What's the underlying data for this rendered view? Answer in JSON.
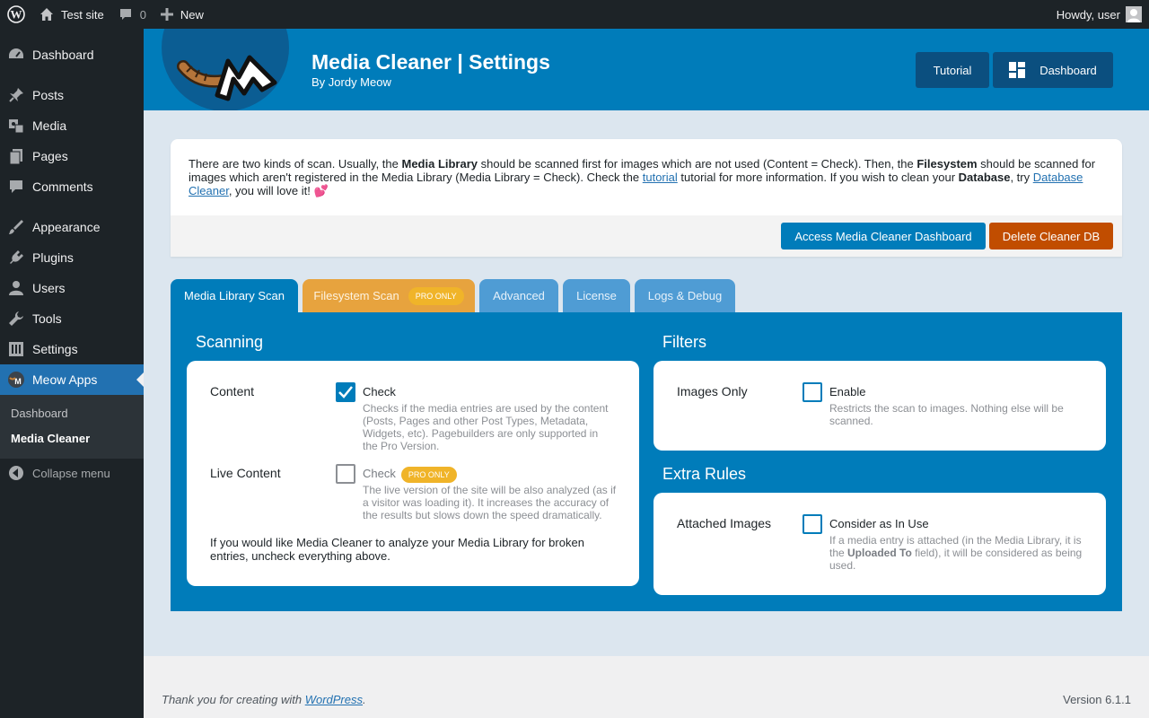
{
  "admin_bar": {
    "site_name": "Test site",
    "comments_count": "0",
    "new_label": "New",
    "greeting": "Howdy, user"
  },
  "sidebar": {
    "items": [
      {
        "label": "Dashboard",
        "icon": "dashboard-icon"
      },
      {
        "label": "Posts",
        "icon": "pin-icon"
      },
      {
        "label": "Media",
        "icon": "media-icon"
      },
      {
        "label": "Pages",
        "icon": "pages-icon"
      },
      {
        "label": "Comments",
        "icon": "comment-icon"
      },
      {
        "label": "Appearance",
        "icon": "brush-icon"
      },
      {
        "label": "Plugins",
        "icon": "plug-icon"
      },
      {
        "label": "Users",
        "icon": "user-icon"
      },
      {
        "label": "Tools",
        "icon": "wrench-icon"
      },
      {
        "label": "Settings",
        "icon": "settings-icon"
      },
      {
        "label": "Meow Apps",
        "icon": "meow-icon"
      }
    ],
    "submenu": [
      {
        "label": "Dashboard"
      },
      {
        "label": "Media Cleaner"
      }
    ],
    "collapse_label": "Collapse menu"
  },
  "header": {
    "title": "Media Cleaner | Settings",
    "byline": "By Jordy Meow",
    "tutorial_button": "Tutorial",
    "dashboard_button": "Dashboard"
  },
  "notice": {
    "t1": "There are two kinds of scan. Usually, the ",
    "b1": "Media Library",
    "t2": " should be scanned first for images which are not used (Content = Check). Then, the ",
    "b2": "Filesystem",
    "t3": " should be scanned for images which aren't registered in the Media Library (Media Library = Check). Check the ",
    "link1": "tutorial",
    "t4": " tutorial for more information. If you wish to clean your ",
    "b3": "Database",
    "t5": ", try ",
    "link2": "Database Cleaner",
    "t6": ", you will love it! 💕",
    "access_button": "Access Media Cleaner Dashboard",
    "delete_button": "Delete Cleaner DB"
  },
  "tabs": [
    {
      "label": "Media Library Scan"
    },
    {
      "label": "Filesystem Scan",
      "badge": "PRO ONLY"
    },
    {
      "label": "Advanced"
    },
    {
      "label": "License"
    },
    {
      "label": "Logs & Debug"
    }
  ],
  "scanning": {
    "title": "Scanning",
    "content_label": "Content",
    "content_check": "Check",
    "content_desc": "Checks if the media entries are used by the content (Posts, Pages and other Post Types, Metadata, Widgets, etc). Pagebuilders are only supported in the Pro Version.",
    "live_label": "Live Content",
    "live_check": "Check",
    "live_badge": "PRO ONLY",
    "live_desc": "The live version of the site will be also analyzed (as if a visitor was loading it). It increases the accuracy of the results but slows down the speed dramatically.",
    "note": "If you would like Media Cleaner to analyze your Media Library for broken entries, uncheck everything above."
  },
  "filters": {
    "title": "Filters",
    "images_label": "Images Only",
    "images_check": "Enable",
    "images_desc": "Restricts the scan to images. Nothing else will be scanned."
  },
  "extra_rules": {
    "title": "Extra Rules",
    "attached_label": "Attached Images",
    "attached_check": "Consider as In Use",
    "attached_desc_1": "If a media entry is attached (in the Media Library, it is the ",
    "attached_desc_bold": "Uploaded To",
    "attached_desc_2": " field), it will be considered as being used."
  },
  "footer": {
    "thanks_prefix": "Thank you for creating with ",
    "thanks_link": "WordPress",
    "thanks_suffix": ".",
    "version": "Version 6.1.1"
  },
  "colors": {
    "accent": "#007cba",
    "admin_bar": "#1d2327",
    "pro_badge": "#f0b429",
    "delete": "#c14d00"
  }
}
